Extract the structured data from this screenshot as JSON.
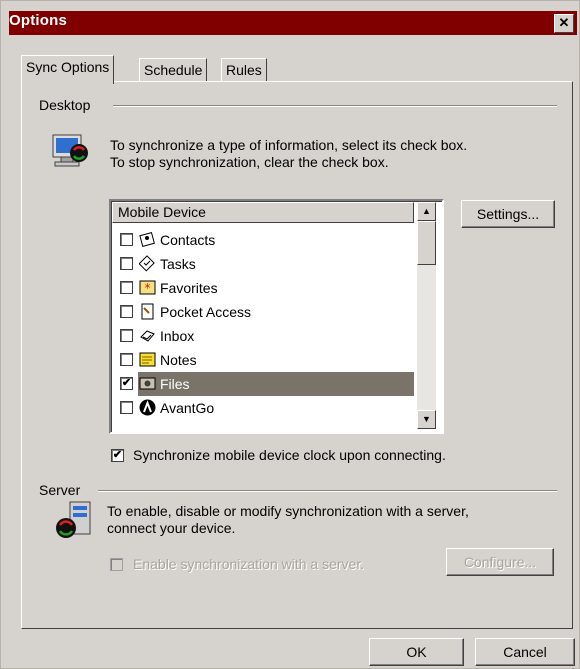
{
  "window": {
    "title": "Options",
    "close_symbol": "✕"
  },
  "tabs": [
    {
      "label": "Sync Options",
      "active": true
    },
    {
      "label": "Schedule",
      "active": false
    },
    {
      "label": "Rules",
      "active": false
    }
  ],
  "desktop": {
    "group_label": "Desktop",
    "instruction_line1": "To synchronize a type of information, select its check box.",
    "instruction_line2": "To stop synchronization, clear the check box.",
    "list_header": "Mobile Device",
    "items": [
      {
        "label": "Contacts",
        "checked": false,
        "icon": "contacts-icon"
      },
      {
        "label": "Tasks",
        "checked": false,
        "icon": "tasks-icon"
      },
      {
        "label": "Favorites",
        "checked": false,
        "icon": "favorites-icon"
      },
      {
        "label": "Pocket Access",
        "checked": false,
        "icon": "pocket-access-icon"
      },
      {
        "label": "Inbox",
        "checked": false,
        "icon": "inbox-icon"
      },
      {
        "label": "Notes",
        "checked": false,
        "icon": "notes-icon"
      },
      {
        "label": "Files",
        "checked": true,
        "selected": true,
        "icon": "files-icon"
      },
      {
        "label": "AvantGo",
        "checked": false,
        "icon": "avantgo-icon"
      }
    ],
    "settings_button": "Settings...",
    "clock_sync_label": "Synchronize mobile device clock upon connecting.",
    "clock_sync_checked": true
  },
  "server": {
    "group_label": "Server",
    "instruction_line1": "To enable, disable or modify synchronization with a server,",
    "instruction_line2": "connect your device.",
    "enable_sync_label": "Enable synchronization with a server.",
    "enable_sync_checked": false,
    "configure_button": "Configure..."
  },
  "footer": {
    "ok_button": "OK",
    "cancel_button": "Cancel"
  },
  "colors": {
    "title_bar": "#800000",
    "dialog_bg": "#d6d3ce",
    "selection": "#7a7369"
  }
}
